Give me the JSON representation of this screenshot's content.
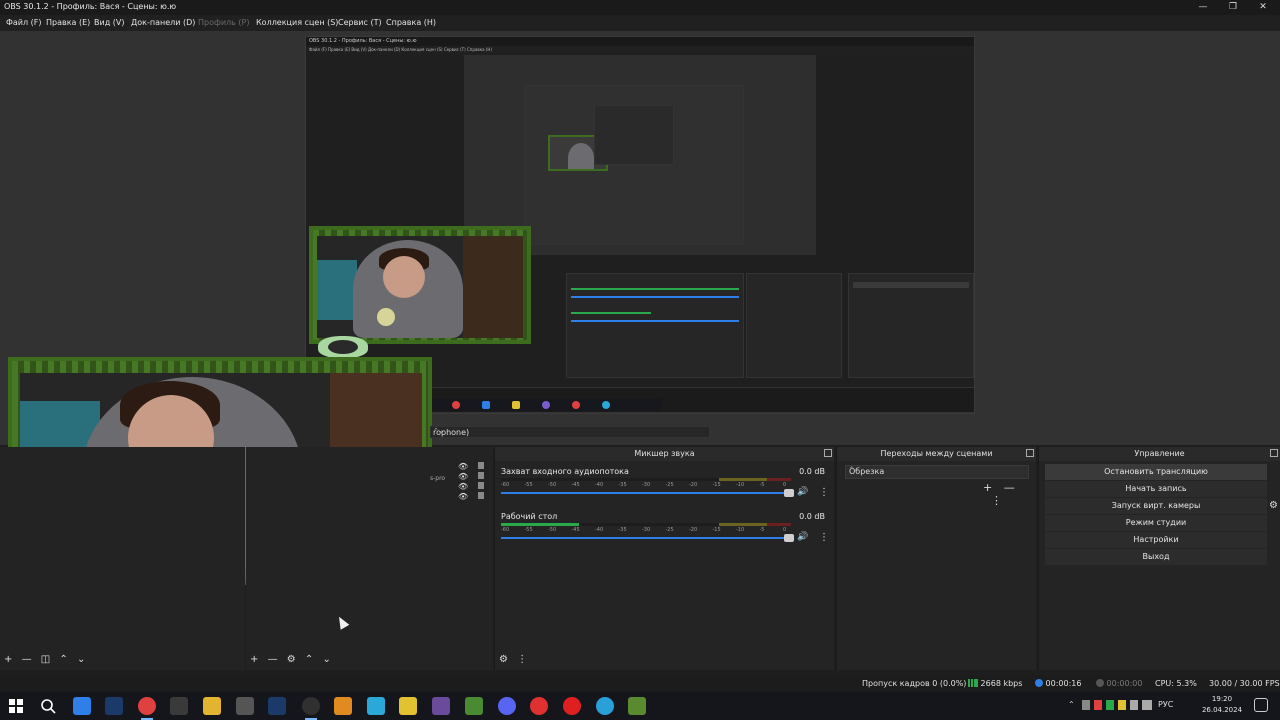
{
  "window": {
    "title": "OBS 30.1.2 - Профиль: Вася - Сцены: ю.ю",
    "minimize": "—",
    "maximize": "❐",
    "close": "✕"
  },
  "menu": [
    "Файл (F)",
    "Правка (E)",
    "Вид (V)",
    "Док-панели (D)",
    "Профиль (P)",
    "Коллекция сцен (S)",
    "Сервис (T)",
    "Справка (H)"
  ],
  "nested": {
    "title": "OBS 30.1.2 - Профиль: Вася - Сцены: ю.ю",
    "menu": "Файл (F)   Правка (E)   Вид (V)   Док-панели (D)   Коллекция сцен (S)   Сервис (T)   Справка (H)"
  },
  "source_toolbar": {
    "label": "rophone)",
    "spinner": "⌃⌄"
  },
  "sources": {
    "partial_name": "s-pro"
  },
  "mixer": {
    "title": "Микшер звука",
    "tick_labels": [
      "-60",
      "-55",
      "-50",
      "-45",
      "-40",
      "-35",
      "-30",
      "-25",
      "-20",
      "-15",
      "-10",
      "-5",
      "0"
    ],
    "channels": [
      {
        "name": "Захват входного аудиопотока",
        "db": "0.0 dB",
        "level": 0
      },
      {
        "name": "Рабочий стол",
        "db": "0.0 dB",
        "level": 0.27
      }
    ]
  },
  "transitions": {
    "title": "Переходы между сценами",
    "selected": "Обрезка",
    "add": "+",
    "remove": "—",
    "more": "⋮"
  },
  "controls": {
    "title": "Управление",
    "buttons": [
      "Остановить трансляцию",
      "Начать запись",
      "Запуск вирт. камеры",
      "Режим студии",
      "Настройки",
      "Выход"
    ],
    "gear": "⚙"
  },
  "status": {
    "dropped": "Пропуск кадров 0 (0.0%)",
    "bitrate": "2668 kbps",
    "stream_time": "00:00:16",
    "rec_time": "00:00:00",
    "cpu": "CPU: 5.3%",
    "fps": "30.00 / 30.00 FPS"
  },
  "taskbar": {
    "lang": "РУС",
    "time": "19:20",
    "date": "26.04.2024"
  },
  "icons": {
    "plus": "+",
    "minus": "—",
    "gear": "⚙",
    "up": "⌃",
    "down": "⌄",
    "filter": "◫",
    "more": "⋮",
    "eye": "👁",
    "speaker": "🔊"
  },
  "colors": {
    "accent": "#2f7fe8",
    "meter_green": "#2aa84a",
    "frame_green": "#4f8a2a"
  }
}
